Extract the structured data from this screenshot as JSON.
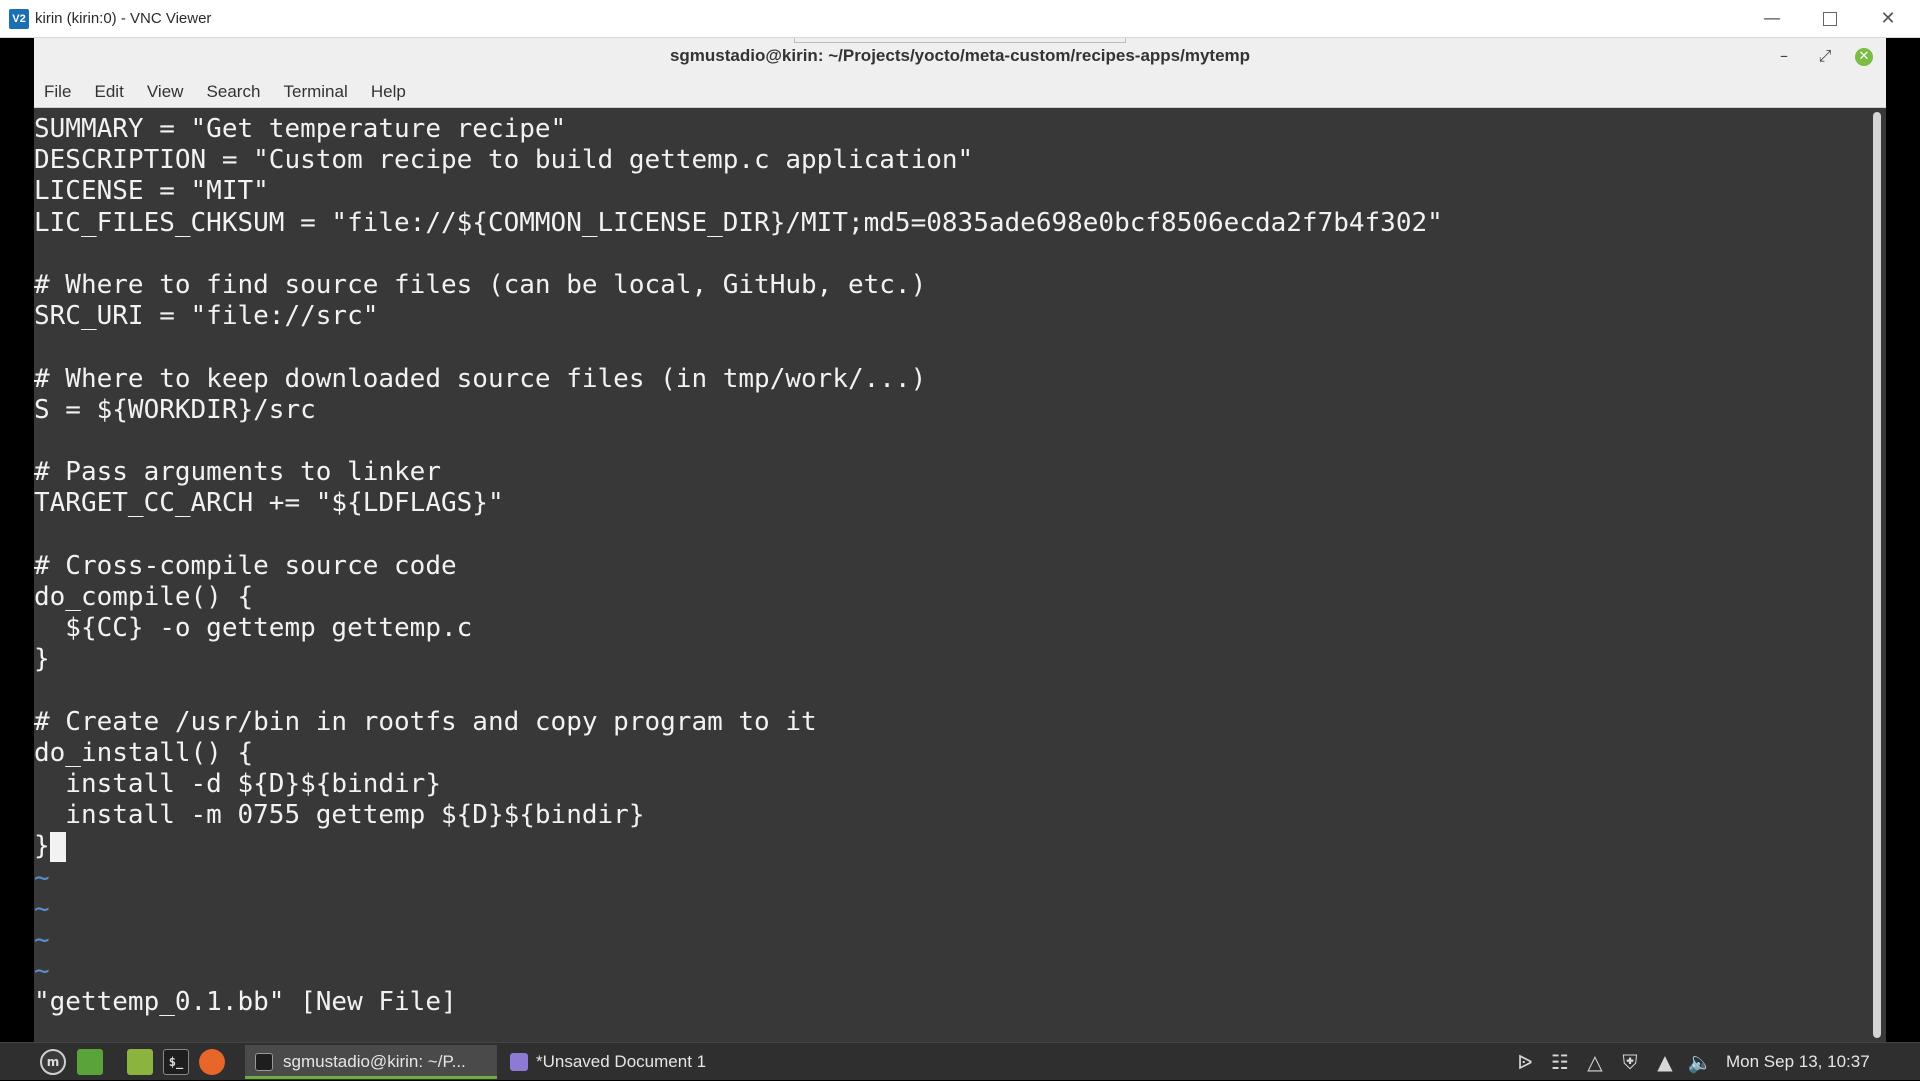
{
  "vnc": {
    "logo": "V2",
    "title": "kirin (kirin:0) - VNC Viewer",
    "controls": {
      "minimize": "minimize-icon",
      "maximize": "maximize-icon",
      "close": "close-icon"
    }
  },
  "terminal": {
    "title": "sgmustadio@kirin: ~/Projects/yocto/meta-custom/recipes-apps/mytemp",
    "menu": [
      "File",
      "Edit",
      "View",
      "Search",
      "Terminal",
      "Help"
    ],
    "lines": [
      "SUMMARY = \"Get temperature recipe\"",
      "DESCRIPTION = \"Custom recipe to build gettemp.c application\"",
      "LICENSE = \"MIT\"",
      "LIC_FILES_CHKSUM = \"file://${COMMON_LICENSE_DIR}/MIT;md5=0835ade698e0bcf8506ecda2f7b4f302\"",
      "",
      "# Where to find source files (can be local, GitHub, etc.)",
      "SRC_URI = \"file://src\"",
      "",
      "# Where to keep downloaded source files (in tmp/work/...)",
      "S = ${WORKDIR}/src",
      "",
      "# Pass arguments to linker",
      "TARGET_CC_ARCH += \"${LDFLAGS}\"",
      "",
      "# Cross-compile source code",
      "do_compile() {",
      "  ${CC} -o gettemp gettemp.c",
      "}",
      "",
      "# Create /usr/bin in rootfs and copy program to it",
      "do_install() {",
      "  install -d ${D}${bindir}",
      "  install -m 0755 gettemp ${D}${bindir}",
      "}"
    ],
    "tildes": [
      "~",
      "~",
      "~",
      "~"
    ],
    "status_line": "\"gettemp_0.1.bb\" [New File]"
  },
  "taskbar": {
    "active_task": "sgmustadio@kirin: ~/P...",
    "inactive_task": "*Unsaved Document 1",
    "clock": "Mon Sep 13, 10:37",
    "tray_icons": [
      "bluetooth-icon",
      "clipboard-icon",
      "update-icon",
      "shield-icon",
      "wifi-icon",
      "volume-icon"
    ]
  }
}
